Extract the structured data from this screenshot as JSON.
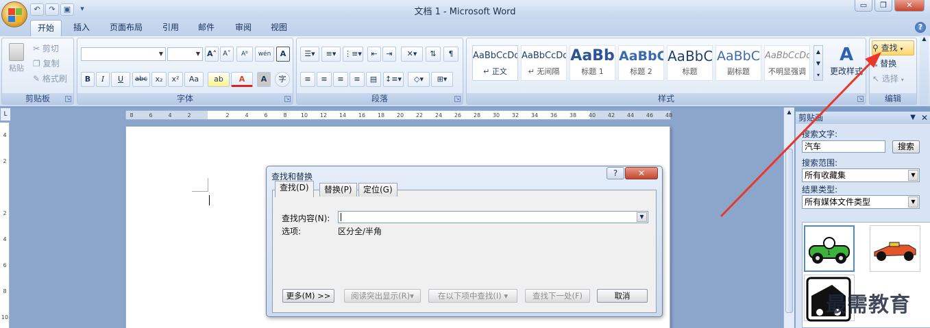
{
  "window": {
    "title": "文档 1 - Microsoft Word"
  },
  "quick_access": {
    "undo": "↶",
    "redo": "↷",
    "save": "▣",
    "customize": "▾"
  },
  "window_controls": {
    "minimize": "▭",
    "restore": "❐",
    "close": "✕"
  },
  "tabs": [
    {
      "label": "开始"
    },
    {
      "label": "插入"
    },
    {
      "label": "页面布局"
    },
    {
      "label": "引用"
    },
    {
      "label": "邮件"
    },
    {
      "label": "审阅"
    },
    {
      "label": "视图"
    }
  ],
  "help": "?",
  "clipboard": {
    "paste": "粘贴",
    "cut": "剪切",
    "copy": "复制",
    "format_painter": "格式刷",
    "label": "剪贴板"
  },
  "font": {
    "label": "字体",
    "name": "",
    "size": "",
    "bold": "B",
    "italic": "I",
    "underline": "U",
    "strike": "abc",
    "sub": "x₂",
    "sup": "x²",
    "case": "Aa",
    "grow": "A˄",
    "shrink": "A˅",
    "clear": "Aᵇ",
    "phonetic": "wén",
    "border": "A",
    "highlight": "ab",
    "color": "A",
    "shade": "A",
    "circle": "字"
  },
  "paragraph": {
    "label": "段落"
  },
  "styles": {
    "label": "样式",
    "items": [
      {
        "sample": "AaBbCcDd",
        "name": "↵ 正文"
      },
      {
        "sample": "AaBbCcDd",
        "name": "↵ 无间隔"
      },
      {
        "sample": "AaBb",
        "name": "标题 1"
      },
      {
        "sample": "AaBbC",
        "name": "标题 2"
      },
      {
        "sample": "AaBbC",
        "name": "标题"
      },
      {
        "sample": "AaBbC",
        "name": "副标题"
      },
      {
        "sample": "AaBbCcDd",
        "name": "不明显强调"
      }
    ],
    "change_styles": "更改样式"
  },
  "editing": {
    "label": "编辑",
    "find": "查找",
    "replace": "替换",
    "select": "选择"
  },
  "ruler": {
    "corner": "L",
    "ticks": [
      "8",
      "6",
      "4",
      "2",
      "",
      "2",
      "4",
      "6",
      "8",
      "10",
      "12",
      "14",
      "16",
      "18",
      "20",
      "22",
      "24",
      "26",
      "28",
      "30",
      "32",
      "34",
      "36",
      "38",
      "40",
      "42",
      "44",
      "46",
      "48"
    ],
    "vticks": [
      "4",
      "2",
      "",
      "2",
      "4",
      "6",
      "8",
      "10"
    ]
  },
  "dialog": {
    "title": "查找和替换",
    "help": "?",
    "close": "✕",
    "tabs": [
      "查找(D)",
      "替换(P)",
      "定位(G)"
    ],
    "find_label": "查找内容(N):",
    "find_value": "",
    "options_label": "选项:",
    "options_value": "区分全/半角",
    "buttons": {
      "more": "更多(M) >>",
      "reading_highlight": "阅读突出显示(R)▾",
      "find_in": "在以下项中查找(I) ▾",
      "find_next": "查找下一处(F)",
      "cancel": "取消"
    }
  },
  "taskpane": {
    "title": "剪贴画",
    "search_label": "搜索文字:",
    "search_value": "汽车",
    "search_button": "搜索",
    "scope_label": "搜索范围:",
    "scope_value": "所有收藏集",
    "type_label": "结果类型:",
    "type_value": "所有媒体文件类型"
  },
  "watermark": "最需教育",
  "colors": {
    "accent_red": "#e8382c",
    "ribbon_blue": "#dde8f6"
  }
}
